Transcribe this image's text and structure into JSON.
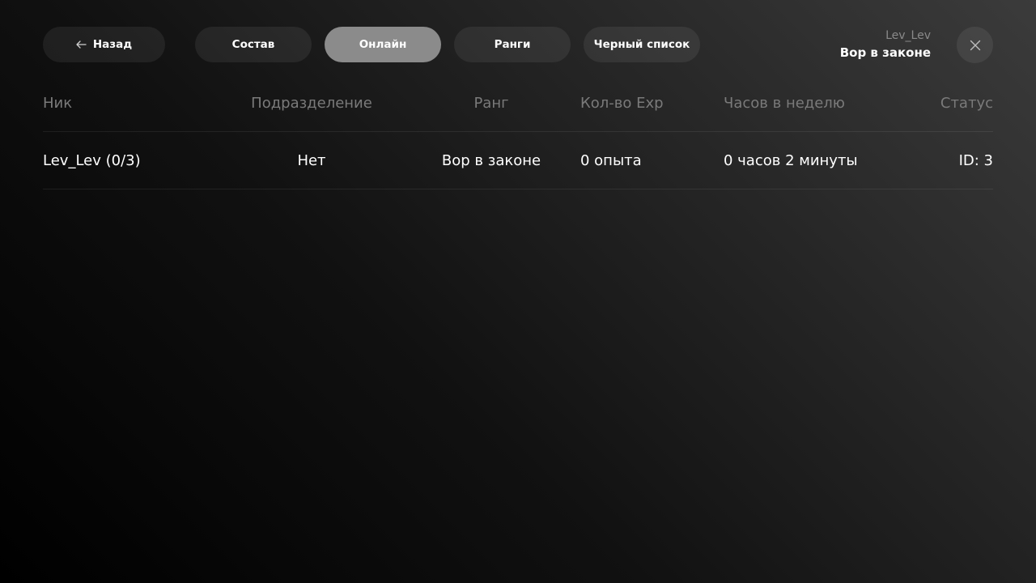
{
  "topbar": {
    "back_label": "Назад",
    "tabs": [
      {
        "label": "Состав",
        "active": false
      },
      {
        "label": "Онлайн",
        "active": true
      },
      {
        "label": "Ранги",
        "active": false
      },
      {
        "label": "Черный список",
        "active": false
      }
    ],
    "user": {
      "name": "Lev_Lev",
      "rank": "Вор в законе"
    }
  },
  "table": {
    "headers": {
      "nick": "Ник",
      "division": "Подразделение",
      "rank": "Ранг",
      "exp": "Кол-во Exp",
      "hours": "Часов в неделю",
      "status": "Статус"
    },
    "rows": [
      {
        "nick": "Lev_Lev (0/3)",
        "division": "Нет",
        "rank": "Вор в законе",
        "exp": "0 опыта",
        "hours": "0 часов 2 минуты",
        "status": "ID: 3"
      }
    ]
  },
  "colors": {
    "accent_active_tab": "#8b8b8b",
    "header_text": "#7a7a7a",
    "muted_text": "#8a8a8a"
  },
  "icons": {
    "back": "arrow-left-icon",
    "close": "close-icon"
  }
}
